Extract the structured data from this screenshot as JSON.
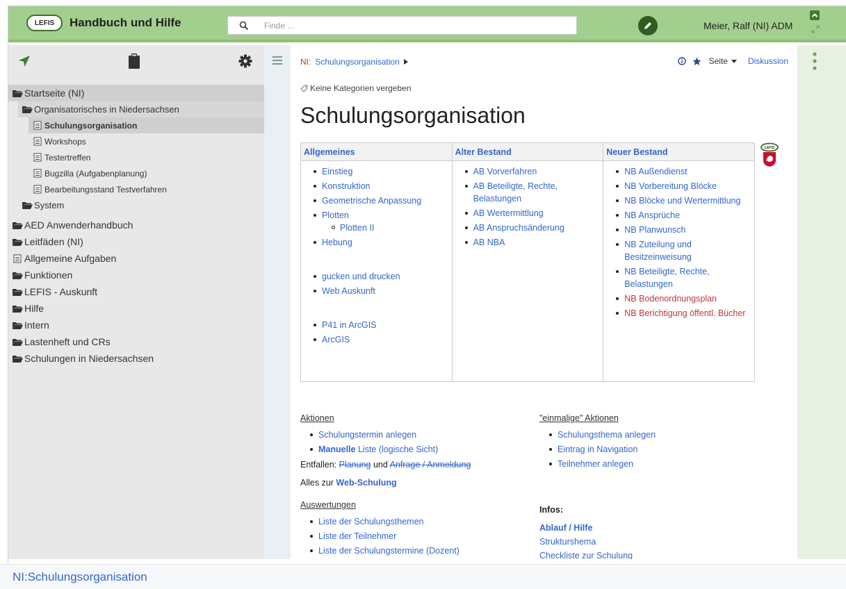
{
  "header": {
    "logo_text": "LEFIS",
    "title": "Handbuch und Hilfe",
    "search_placeholder": "Finde ...",
    "user": "Meier, Ralf (NI) ADM"
  },
  "sidebar": {
    "tree": [
      {
        "label": "Startseite (NI)",
        "level": 0,
        "type": "folder"
      },
      {
        "label": "Organisatorisches in Niedersachsen",
        "level": 1,
        "type": "folder"
      },
      {
        "label": "Schulungsorganisation",
        "level": 2,
        "type": "page"
      },
      {
        "label": "Workshops",
        "level": 2,
        "type": "page"
      },
      {
        "label": "Testertreffen",
        "level": 2,
        "type": "page"
      },
      {
        "label": "Bugzilla (Aufgabenplanung)",
        "level": 2,
        "type": "page"
      },
      {
        "label": "Bearbeitungsstand Testverfahren",
        "level": 2,
        "type": "page"
      },
      {
        "label": "System",
        "level": 1,
        "type": "folder"
      },
      {
        "label": "AED Anwenderhandbuch",
        "level": 0,
        "type": "folder"
      },
      {
        "label": "Leitfäden (NI)",
        "level": 0,
        "type": "folder"
      },
      {
        "label": "Allgemeine Aufgaben",
        "level": 0,
        "type": "page"
      },
      {
        "label": "Funktionen",
        "level": 0,
        "type": "folder"
      },
      {
        "label": "LEFIS - Auskunft",
        "level": 0,
        "type": "folder"
      },
      {
        "label": "Hilfe",
        "level": 0,
        "type": "folder"
      },
      {
        "label": "Intern",
        "level": 0,
        "type": "folder"
      },
      {
        "label": "Lastenheft und CRs",
        "level": 0,
        "type": "folder"
      },
      {
        "label": "Schulungen in Niedersachsen",
        "level": 0,
        "type": "folder"
      }
    ]
  },
  "breadcrumb": {
    "prefix": "NI:",
    "page": "Schulungsorganisation"
  },
  "page_tools": {
    "seite": "Seite",
    "diskussion": "Diskussion"
  },
  "categories": "Keine Kategorien vergeben",
  "title": "Schulungsorganisation",
  "table": {
    "headers": [
      "Allgemeines",
      "Alter Bestand",
      "Neuer Bestand"
    ],
    "col1": [
      "Einstieg",
      "Konstruktion",
      "Geometrische Anpassung",
      "Plotten",
      "Plotten II",
      "Hebung",
      "gucken und drucken",
      "Web Auskunft",
      "P41 in ArcGIS",
      "ArcGIS"
    ],
    "col2": [
      "AB Vorverfahren",
      "AB Beteiligte, Rechte, Belastungen",
      "AB Wertermittlung",
      "AB Anspruchsänderung",
      "AB NBA"
    ],
    "col3": [
      "NB Außendienst",
      "NB Vorbereitung Blöcke",
      "NB Blöcke und Wertermittlung",
      "NB Ansprüche",
      "NB Planwunsch",
      "NB Zuteilung und Besitzeinweisung",
      "NB Beteiligte, Rechte, Belastungen",
      "NB Bodenordnungsplan",
      "NB Berichtigung öffentl. Bücher"
    ]
  },
  "aktionen": {
    "heading": "Aktionen",
    "items": [
      "Schulungstermin anlegen"
    ],
    "manuelle_bold": "Manuelle",
    "manuelle_rest": "Liste (logische Sicht)",
    "entfallen_label": "Entfallen:",
    "entfallen_a": "Planung",
    "entfallen_und": "und",
    "entfallen_b": "Anfrage / Anmeldung",
    "web_prefix": "Alles zur",
    "web_link": "Web-Schulung"
  },
  "einmalige": {
    "heading": "\"einmalige\" Aktionen",
    "items": [
      "Schulungsthema anlegen",
      "Eintrag in Navigation",
      "Teilnehmer anlegen"
    ]
  },
  "auswertungen": {
    "heading": "Auswertungen",
    "items": [
      "Liste der Schulungsthemen",
      "Liste der Teilnehmer",
      "Liste der Schulungstermine (Dozent)"
    ]
  },
  "infos": {
    "heading": "Infos:",
    "ablauf": "Ablauf / Hilfe",
    "struktur": "Strukturshema",
    "checkliste": "Checkliste zur Schulung"
  },
  "footer": "NI:Schulungsorganisation"
}
